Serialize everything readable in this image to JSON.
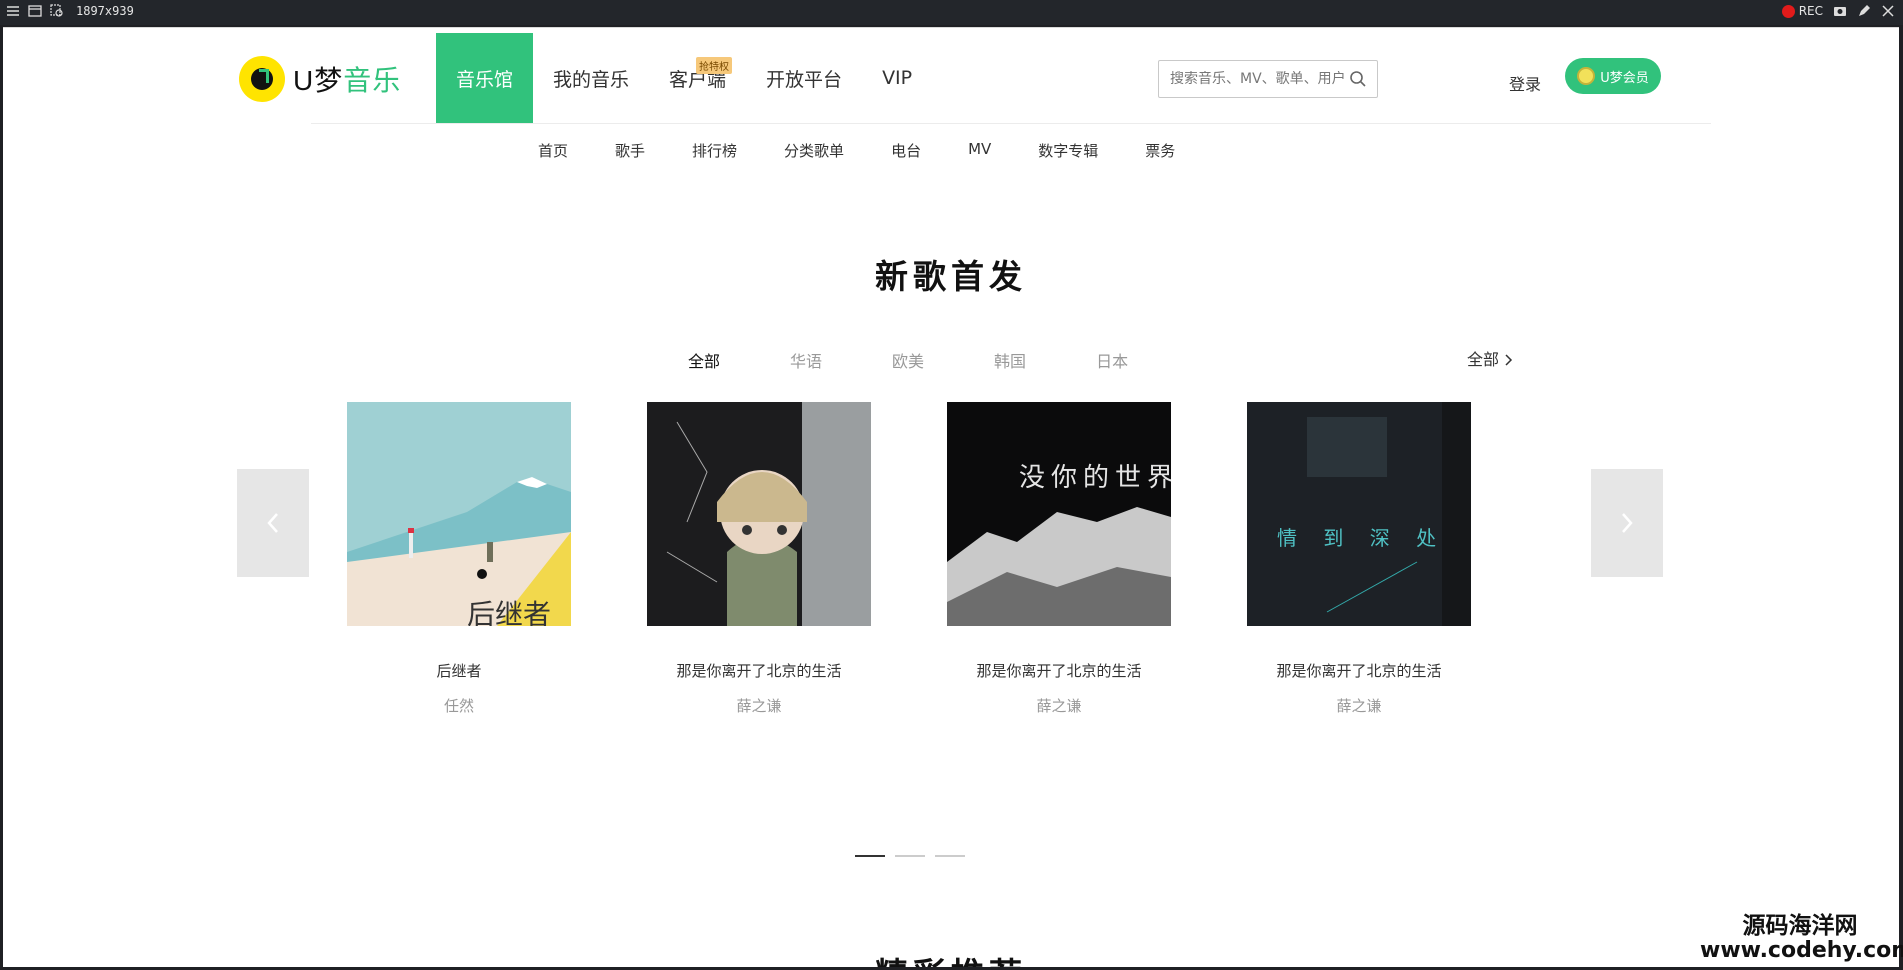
{
  "window": {
    "dimensions": "1897x939",
    "rec_label": "REC"
  },
  "header": {
    "logo_text_a": "U梦",
    "logo_text_b": "音乐",
    "nav": [
      {
        "label": "音乐馆",
        "active": true
      },
      {
        "label": "我的音乐",
        "active": false
      },
      {
        "label": "客户端",
        "active": false,
        "badge": "抢特权"
      },
      {
        "label": "开放平台",
        "active": false
      },
      {
        "label": "VIP",
        "active": false
      }
    ],
    "search_placeholder": "搜索音乐、MV、歌单、用户",
    "login": "登录",
    "vip_button": "U梦会员"
  },
  "subnav": [
    "首页",
    "歌手",
    "排行榜",
    "分类歌单",
    "电台",
    "MV",
    "数字专辑",
    "票务"
  ],
  "new_songs": {
    "title": "新歌首发",
    "tabs": [
      "全部",
      "华语",
      "欧美",
      "韩国",
      "日本"
    ],
    "active_tab": 0,
    "all_link": "全部",
    "cards": [
      {
        "title": "后继者",
        "artist": "任然",
        "cover_text": "后继者"
      },
      {
        "title": "那是你离开了北京的生活",
        "artist": "薛之谦",
        "cover_text": ""
      },
      {
        "title": "那是你离开了北京的生活",
        "artist": "薛之谦",
        "cover_text": "没你的世界"
      },
      {
        "title": "那是你离开了北京的生活",
        "artist": "薛之谦",
        "cover_text": "情 到 深 处"
      }
    ],
    "pages": 3,
    "active_page": 0
  },
  "next_section_title": "精彩推荐",
  "watermark": {
    "line1": "源码海洋网",
    "line2": "www.codehy.com"
  },
  "colors": {
    "accent": "#31c27c"
  }
}
